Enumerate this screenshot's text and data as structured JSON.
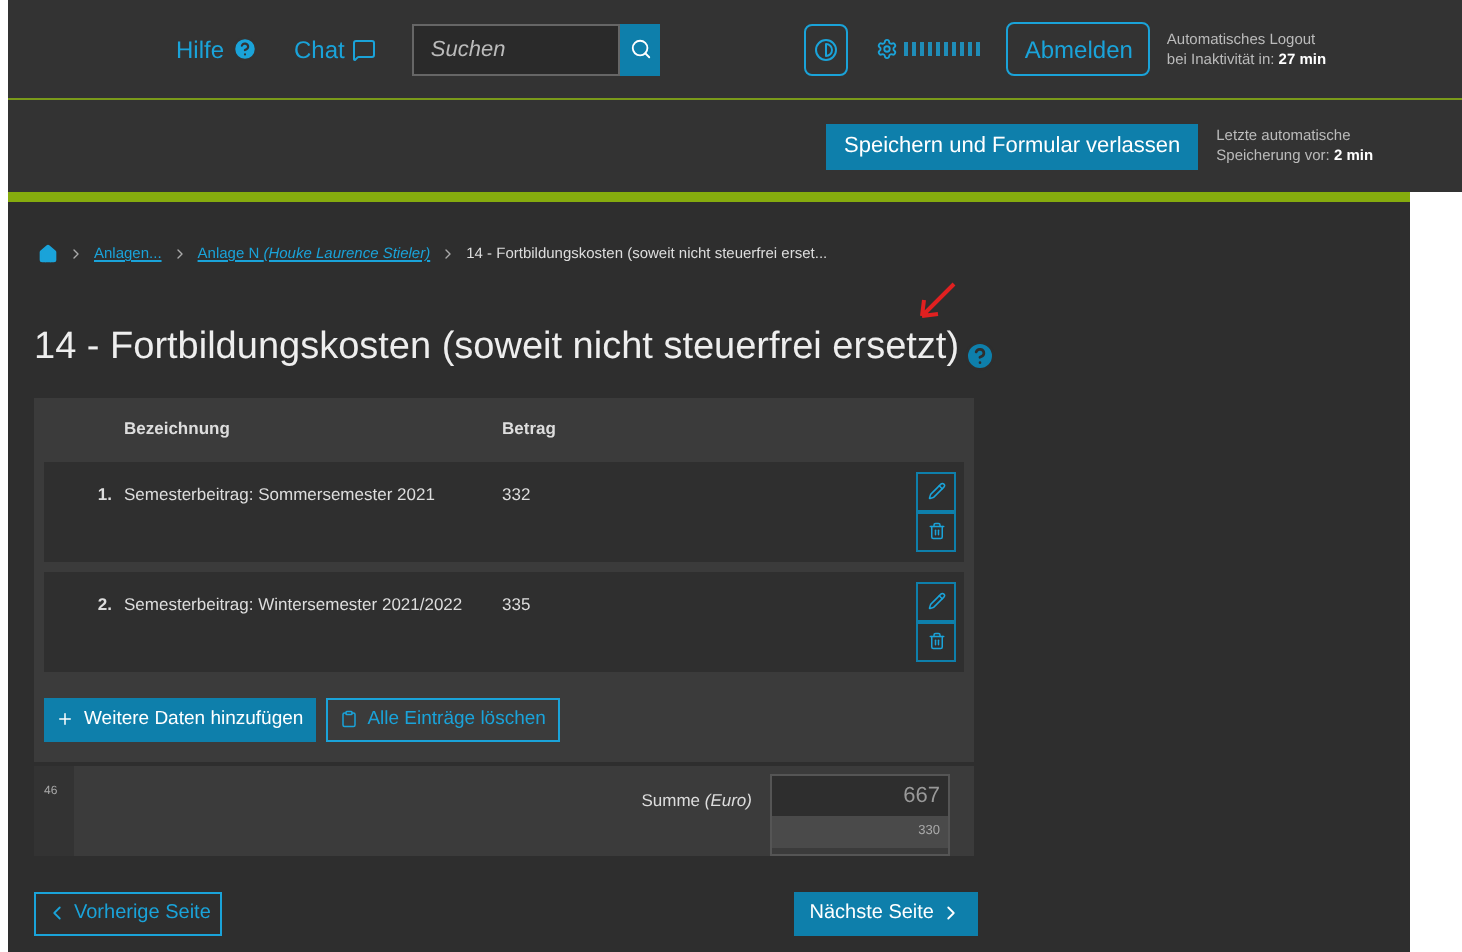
{
  "header": {
    "help": "Hilfe",
    "chat": "Chat",
    "search": {
      "placeholder": "Suchen"
    },
    "logout": "Abmelden",
    "logout_info": {
      "line1": "Automatisches Logout",
      "line2": "bei Inaktivität in: **27 min**"
    }
  },
  "toolbar": {
    "save_button": "Speichern und Formular verlassen",
    "autosave": {
      "line1": "Letzte automatische",
      "line2": "Speicherung vor: **2 min**"
    }
  },
  "breadcrumb": [
    {
      "label": "Anlagen...",
      "link": true
    },
    {
      "label": "Anlage N *(Houke Laurence Stieler)*",
      "link": true
    },
    {
      "label": "14 - Fortbildungskosten (soweit nicht steuerfrei erset...",
      "link": false
    }
  ],
  "title": "14 - Fortbildungskosten (soweit nicht steuerfrei ersetzt)",
  "table": {
    "columns": [
      "Bezeichnung",
      "Betrag"
    ],
    "rows": [
      {
        "number": "1.",
        "bezeichnung": "Semesterbeitrag: Sommersemester 2021",
        "betrag": "332"
      },
      {
        "number": "2.",
        "bezeichnung": "Semesterbeitrag: Wintersemester 2021/2022",
        "betrag": "335"
      }
    ]
  },
  "add_button": "Weitere Daten hinzufügen",
  "delete_all_button": "Alle Einträge löschen",
  "sum": {
    "line_number": "46",
    "label": "Summe *(Euro)*",
    "value": "667",
    "sub_value": "330"
  },
  "nav": {
    "previous": "Vorherige Seite",
    "next": "Nächste Seite"
  }
}
